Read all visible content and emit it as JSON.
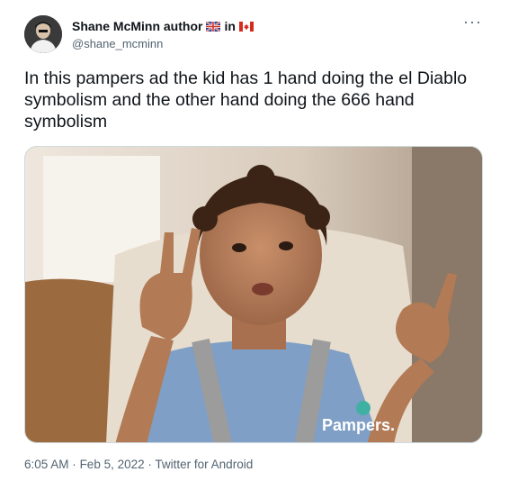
{
  "author": {
    "name": "Shane McMinn author",
    "handle": "@shane_mcminn",
    "name_suffix": "in"
  },
  "tweet": {
    "text": "In this pampers ad the kid has 1 hand doing the el Diablo symbolism and the other hand doing the 666 hand symbolism"
  },
  "media": {
    "watermark": "Pampers."
  },
  "meta": {
    "time": "6:05 AM",
    "separator": "·",
    "date": "Feb 5, 2022",
    "source": "Twitter for Android"
  },
  "icons": {
    "more": "more-icon",
    "flag_uk": "uk-flag-icon",
    "flag_canada": "canada-flag-icon"
  },
  "colors": {
    "text_primary": "#0f1419",
    "text_secondary": "#536471",
    "border": "#cfd9de"
  }
}
